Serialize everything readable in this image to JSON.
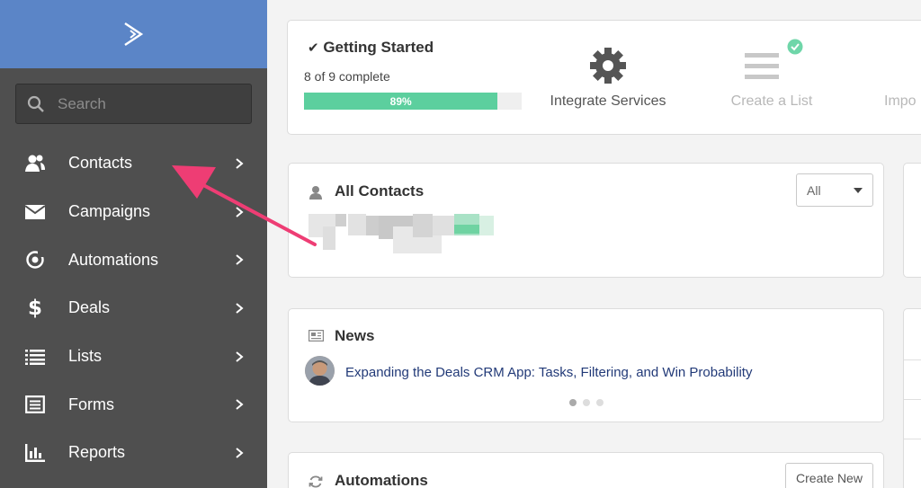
{
  "sidebar": {
    "search_placeholder": "Search",
    "items": [
      {
        "label": "Contacts",
        "icon": "contacts-icon"
      },
      {
        "label": "Campaigns",
        "icon": "envelope-icon"
      },
      {
        "label": "Automations",
        "icon": "automation-icon"
      },
      {
        "label": "Deals",
        "icon": "dollar-icon"
      },
      {
        "label": "Lists",
        "icon": "list-icon"
      },
      {
        "label": "Forms",
        "icon": "form-icon"
      },
      {
        "label": "Reports",
        "icon": "bar-chart-icon"
      }
    ]
  },
  "getting_started": {
    "title": "Getting Started",
    "subtitle": "8 of 9 complete",
    "progress_label": "89%",
    "progress_value": 0.89,
    "steps": [
      {
        "label": "Integrate Services",
        "icon": "gear-icon"
      },
      {
        "label": "Create a List",
        "icon": "list-lines-icon",
        "done": true
      },
      {
        "label": "Impo",
        "icon": "import-icon"
      }
    ]
  },
  "all_contacts": {
    "title": "All Contacts",
    "filter_value": "All"
  },
  "news": {
    "title": "News",
    "headline": "Expanding the Deals CRM App: Tasks, Filtering, and Win Probability"
  },
  "automations": {
    "title": "Automations",
    "create_label": "Create New"
  },
  "colors": {
    "sidebar": "#4f4f4f",
    "sidebar_top": "#5b85c7",
    "progress": "#5ccf9e",
    "arrow": "#ee3d74"
  }
}
